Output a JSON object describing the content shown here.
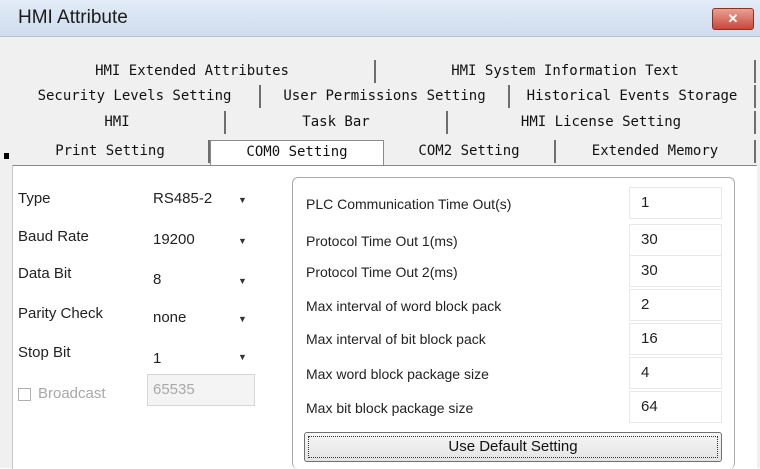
{
  "window": {
    "title": "HMI Attribute",
    "close_label": "✕"
  },
  "tabs": {
    "row1": [
      "HMI Extended Attributes",
      "HMI System Information Text"
    ],
    "row2": [
      "Security Levels Setting",
      "User Permissions Setting",
      "Historical Events Storage"
    ],
    "row3": [
      "HMI",
      "Task Bar",
      "HMI License Setting"
    ],
    "row4": [
      "Print Setting",
      "COM0 Setting",
      "COM2 Setting",
      "Extended Memory"
    ],
    "active": "COM0 Setting"
  },
  "com_settings": {
    "type": {
      "label": "Type",
      "value": "RS485-2"
    },
    "baud_rate": {
      "label": "Baud Rate",
      "value": "19200"
    },
    "data_bit": {
      "label": "Data Bit",
      "value": "8"
    },
    "parity_check": {
      "label": "Parity Check",
      "value": "none"
    },
    "stop_bit": {
      "label": "Stop Bit",
      "value": "1"
    },
    "broadcast": {
      "label": "Broadcast",
      "value": "65535",
      "checked": false,
      "enabled": false
    }
  },
  "plc_settings": [
    {
      "label": "PLC Communication Time Out(s)",
      "value": "1"
    },
    {
      "label": "Protocol Time Out 1(ms)",
      "value": "30"
    },
    {
      "label": "Protocol Time Out 2(ms)",
      "value": "30"
    },
    {
      "label": "Max interval of word block pack",
      "value": "2"
    },
    {
      "label": "Max interval of bit block pack",
      "value": "16"
    },
    {
      "label": "Max word block package size",
      "value": "4"
    },
    {
      "label": "Max bit block package size",
      "value": "64"
    }
  ],
  "buttons": {
    "use_default": "Use Default Setting"
  },
  "icons": {
    "dropdown": "chevron-down-icon",
    "close": "close-icon",
    "checkbox": "checkbox-icon"
  }
}
